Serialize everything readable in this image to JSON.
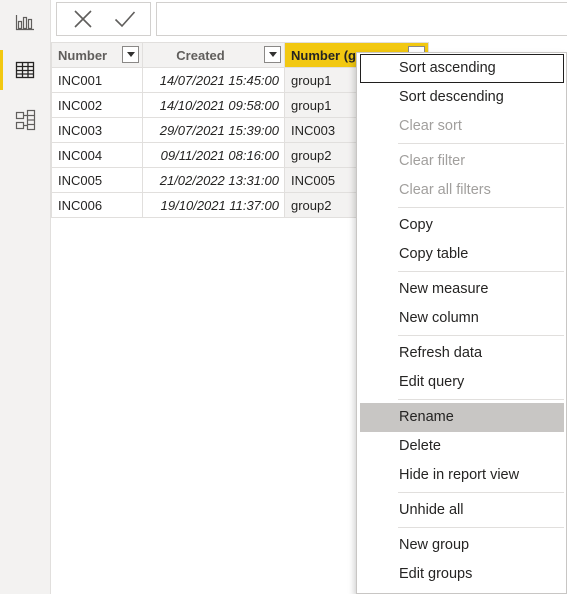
{
  "app": {
    "nav": [
      {
        "name": "report-view",
        "icon": "bar-chart-icon"
      },
      {
        "name": "data-view",
        "icon": "table-icon",
        "active": true
      },
      {
        "name": "model-view",
        "icon": "model-icon"
      }
    ],
    "formula_bar": {
      "cancel_icon": "close-icon",
      "commit_icon": "check-icon",
      "value": ""
    }
  },
  "table": {
    "columns": [
      {
        "label": "Number"
      },
      {
        "label": "Created"
      },
      {
        "label": "Number (groups)",
        "visible_text": "Number (gr",
        "selected": true
      }
    ],
    "rows": [
      [
        "INC001",
        "14/07/2021 15:45:00",
        "group1"
      ],
      [
        "INC002",
        "14/10/2021 09:58:00",
        "group1"
      ],
      [
        "INC003",
        "29/07/2021 15:39:00",
        "INC003"
      ],
      [
        "INC004",
        "09/11/2021 08:16:00",
        "group2"
      ],
      [
        "INC005",
        "21/02/2022 13:31:00",
        "INC005"
      ],
      [
        "INC006",
        "19/10/2021 11:37:00",
        "group2"
      ]
    ]
  },
  "context_menu": {
    "items": [
      {
        "label": "Sort ascending",
        "state": "focused"
      },
      {
        "label": "Sort descending"
      },
      {
        "label": "Clear sort",
        "state": "disabled"
      },
      {
        "label": "Clear filter",
        "state": "disabled"
      },
      {
        "label": "Clear all filters",
        "state": "disabled"
      },
      {
        "label": "Copy"
      },
      {
        "label": "Copy table"
      },
      {
        "label": "New measure"
      },
      {
        "label": "New column"
      },
      {
        "label": "Refresh data"
      },
      {
        "label": "Edit query"
      },
      {
        "label": "Rename",
        "state": "hover"
      },
      {
        "label": "Delete"
      },
      {
        "label": "Hide in report view"
      },
      {
        "label": "Unhide all"
      },
      {
        "label": "New group"
      },
      {
        "label": "Edit groups"
      }
    ]
  },
  "colors": {
    "accent": "#f2c811",
    "disabled_text": "#a19f9d",
    "hover_bg": "#c8c6c4"
  }
}
